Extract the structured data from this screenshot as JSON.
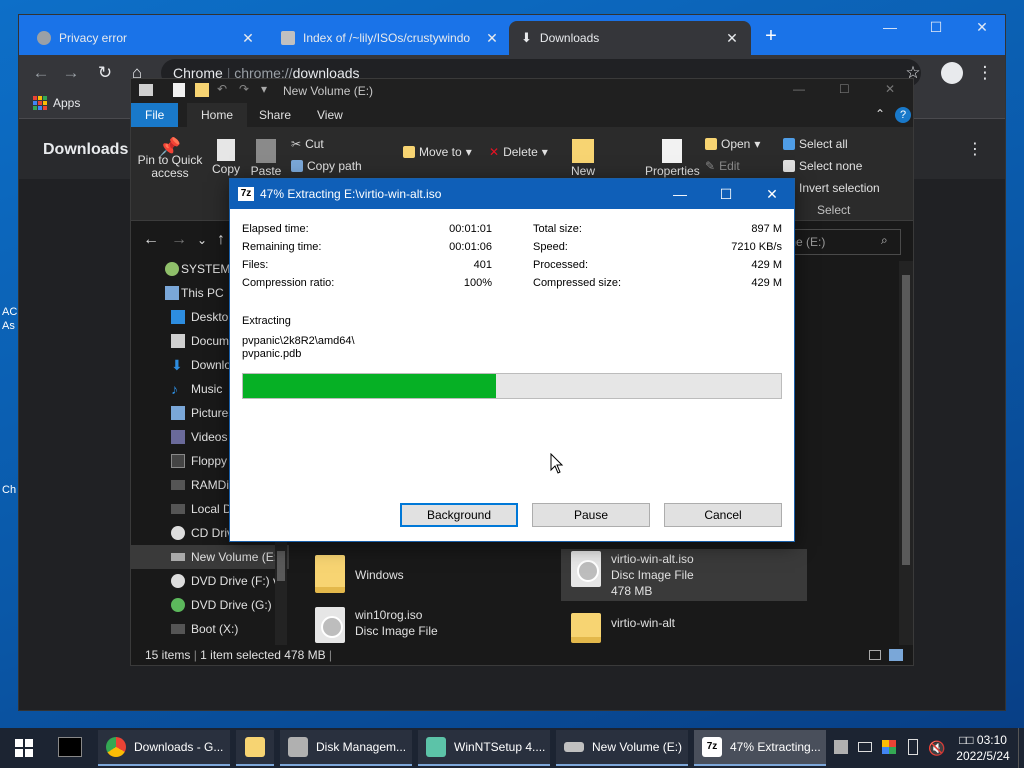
{
  "desktop": {
    "left_text": [
      "AC",
      "As",
      "Ch"
    ]
  },
  "chrome": {
    "tabs": [
      {
        "title": "Privacy error",
        "close": "✕"
      },
      {
        "title": "Index of /~lily/ISOs/crustywindo",
        "close": "✕"
      },
      {
        "title": "Downloads",
        "close": "✕"
      }
    ],
    "new_tab": "+",
    "address_prefix": "Chrome",
    "address_scheme": "chrome://",
    "address_host": "downloads",
    "bookmarks": {
      "apps": "Apps"
    },
    "page_title": "Downloads",
    "window_controls": {
      "min": "—",
      "max": "☐",
      "close": "✕"
    }
  },
  "explorer": {
    "title": "New Volume (E:)",
    "tabs": [
      "File",
      "Home",
      "Share",
      "View"
    ],
    "ribbon": {
      "pin": "Pin to Quick access",
      "copy": "Copy",
      "paste": "Paste",
      "cut": "Cut",
      "copy_path": "Copy path",
      "move_to": "Move to",
      "delete": "Delete",
      "new": "New",
      "properties": "Properties",
      "open": "Open",
      "edit": "Edit",
      "select_all": "Select all",
      "select_none": "Select none",
      "invert_selection": "Invert selection",
      "group_select": "Select"
    },
    "search_placeholder": "me (E:)",
    "tree": [
      {
        "label": "SYSTEM"
      },
      {
        "label": "This PC"
      },
      {
        "label": "Desktop"
      },
      {
        "label": "Documents"
      },
      {
        "label": "Downloads"
      },
      {
        "label": "Music"
      },
      {
        "label": "Pictures"
      },
      {
        "label": "Videos"
      },
      {
        "label": "Floppy"
      },
      {
        "label": "RAMDisk"
      },
      {
        "label": "Local Disk"
      },
      {
        "label": "CD Drive (D:)"
      },
      {
        "label": "New Volume (E:)"
      },
      {
        "label": "DVD Drive (F:) v"
      },
      {
        "label": "DVD Drive (G:)"
      },
      {
        "label": "Boot (X:)"
      }
    ],
    "files": [
      {
        "name": "Windows",
        "type": "",
        "size": ""
      },
      {
        "name": "virtio-win-alt.iso",
        "type": "Disc Image File",
        "size": "478 MB"
      },
      {
        "name": "win10rog.iso",
        "type": "Disc Image File",
        "size": ""
      },
      {
        "name": "virtio-win-alt",
        "type": "",
        "size": ""
      }
    ],
    "status": {
      "count": "15 items",
      "selected": "1 item selected",
      "size": "478 MB"
    }
  },
  "dialog": {
    "title": "47% Extracting E:\\virtio-win-alt.iso",
    "progress": 0.47,
    "left": [
      {
        "k": "Elapsed time:",
        "v": "00:01:01"
      },
      {
        "k": "Remaining time:",
        "v": "00:01:06"
      },
      {
        "k": "Files:",
        "v": "401"
      },
      {
        "k": "Compression ratio:",
        "v": "100%"
      }
    ],
    "right": [
      {
        "k": "Total size:",
        "v": "897 M"
      },
      {
        "k": "Speed:",
        "v": "7210 KB/s"
      },
      {
        "k": "Processed:",
        "v": "429 M"
      },
      {
        "k": "Compressed size:",
        "v": "429 M"
      }
    ],
    "extracting_label": "Extracting",
    "path_line1": "pvpanic\\2k8R2\\amd64\\",
    "path_line2": "pvpanic.pdb",
    "buttons": {
      "background": "Background",
      "pause": "Pause",
      "cancel": "Cancel"
    }
  },
  "taskbar": {
    "items": [
      {
        "label": "Downloads - G..."
      },
      {
        "label": ""
      },
      {
        "label": "Disk Managem..."
      },
      {
        "label": "WinNTSetup 4...."
      },
      {
        "label": "New Volume (E:)"
      },
      {
        "label": "47% Extracting..."
      }
    ],
    "time": "03:10",
    "time_prefix": "□□",
    "date": "2022/5/24"
  }
}
